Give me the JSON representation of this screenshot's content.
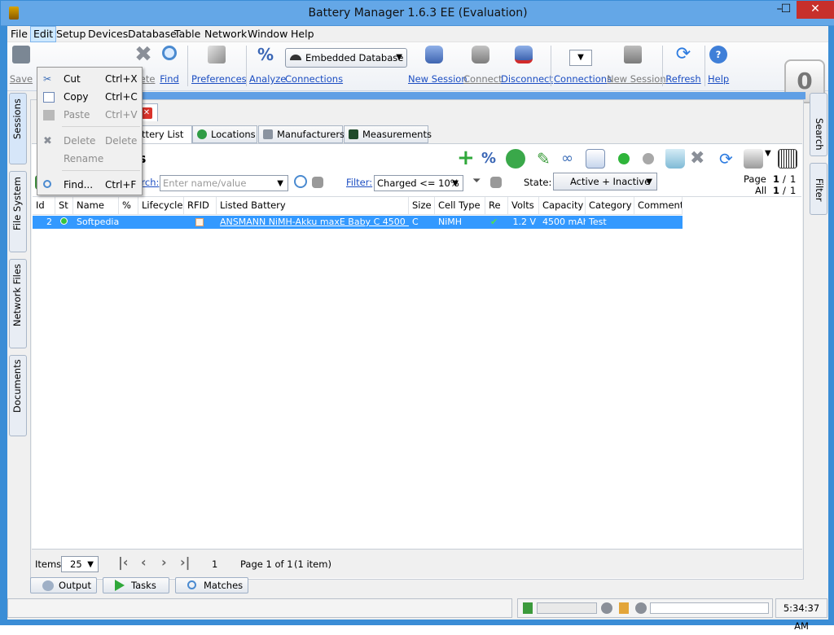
{
  "window": {
    "title": "Battery Manager 1.6.3 EE (Evaluation)",
    "minimize": "–",
    "maximize": "☐",
    "close": "✕"
  },
  "menubar": [
    "File",
    "Edit",
    "Setup",
    "Devices",
    "Database",
    "Table",
    "Network",
    "Window",
    "Help"
  ],
  "toolbar": {
    "save": "Save",
    "delete": "elete",
    "find": "Find",
    "preferences": "Preferences",
    "analyze": "Analyze",
    "connections": "Connections",
    "database_select": "Embedded Database",
    "new_session": "New Session",
    "connect": "Connect",
    "disconnect": "Disconnect",
    "net_connections": "Connections",
    "net_new_session": "New Session",
    "refresh": "Refresh",
    "help": "Help",
    "counter": "0"
  },
  "left_dock": [
    "Sessions",
    "File System",
    "Network Files",
    "Documents"
  ],
  "right_dock": [
    "Search",
    "Filter"
  ],
  "edit_menu": [
    {
      "label": "Cut",
      "shortcut": "Ctrl+X",
      "enabled": true
    },
    {
      "label": "Copy",
      "shortcut": "Ctrl+C",
      "enabled": true
    },
    {
      "label": "Paste",
      "shortcut": "Ctrl+V",
      "enabled": false
    },
    {
      "label": "Delete",
      "shortcut": "Delete",
      "enabled": false
    },
    {
      "label": "Rename",
      "shortcut": "",
      "enabled": false
    },
    {
      "label": "Find...",
      "shortcut": "Ctrl+F",
      "enabled": true
    }
  ],
  "doc_tab": {
    "close": "✕"
  },
  "subtabs": [
    "attery List",
    "Locations",
    "Manufacturers",
    "Measurements"
  ],
  "panel": {
    "title": "es",
    "search_label": "Search:",
    "search_placeholder": "Enter name/value",
    "filter_label": "Filter:",
    "filter_value": "Charged <= 10%",
    "state_label": "State:",
    "state_value": "Active + Inactive",
    "page_label": "Page",
    "page_value": "1",
    "page_sep": "/",
    "page_total": "1",
    "all_label": "All",
    "all_value": "1",
    "all_total": "1"
  },
  "grid": {
    "columns": [
      "Id",
      "St",
      "Name",
      "%",
      "Lifecycle",
      "RFID",
      "Listed Battery",
      "Size",
      "Cell Type",
      "Re",
      "Volts",
      "Capacity",
      "Category",
      "Comment"
    ],
    "row": {
      "id": "2",
      "name": "Softpedia",
      "listed_battery": "ANSMANN NiMH-Akku maxE Baby C 4500 mAh",
      "size": "C",
      "cell_type": "NiMH",
      "volts": "1.2 V",
      "capacity": "4500 mAh",
      "category": "Test"
    }
  },
  "pager": {
    "items_label": "Items",
    "items_value": "25",
    "current_page": "1",
    "page_info": "Page 1 of 1",
    "item_count": "(1 item)"
  },
  "bottom_tabs": [
    "Output",
    "Tasks",
    "Matches"
  ],
  "status": {
    "clock": "5:34:37 AM"
  },
  "colors": {
    "title_bar": "#64a7e7",
    "selection": "#3399ff",
    "link": "#1c4ec2",
    "accent_line": "#5f9fe5"
  }
}
